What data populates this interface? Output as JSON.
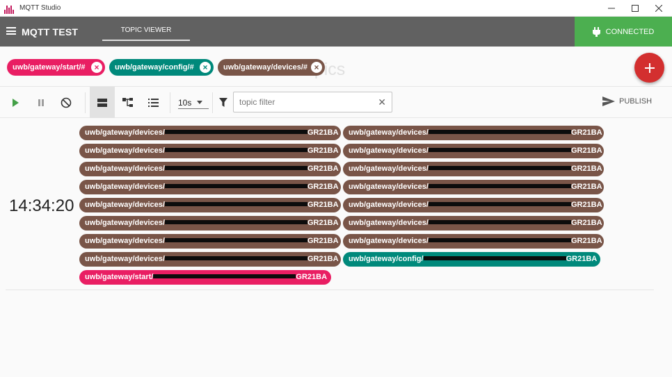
{
  "window": {
    "title": "MQTT Studio"
  },
  "appbar": {
    "name": "MQTT TEST",
    "tab_label": "TOPIC VIEWER",
    "status_label": "CONNECTED"
  },
  "subscriptions": {
    "bg_label": "d Topics",
    "chips": [
      {
        "label": "uwb/gateway/start/#",
        "color": "#e91e63"
      },
      {
        "label": "uwb/gateway/config/#",
        "color": "#00897b"
      },
      {
        "label": "uwb/gateway/devices/#",
        "color": "#795548"
      }
    ]
  },
  "toolbar": {
    "interval_value": "10s",
    "filter_placeholder": "topic filter",
    "publish_label": "PUBLISH"
  },
  "messages": {
    "timestamp": "14:34:20",
    "device_prefix": "uwb/gateway/devices/",
    "config_prefix": "uwb/gateway/config/",
    "start_prefix": "uwb/gateway/start/",
    "suffix": "GR21BA"
  },
  "colors": {
    "devices": "#795548",
    "config": "#00897b",
    "start": "#e91e63",
    "connected": "#4caf50",
    "fab": "#d32f2f"
  }
}
